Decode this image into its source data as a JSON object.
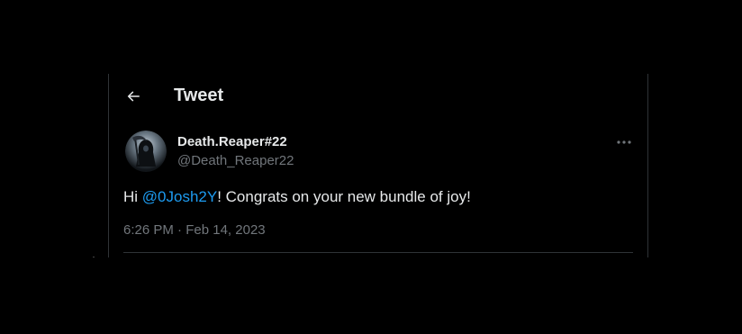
{
  "header": {
    "title": "Tweet",
    "back_icon": "arrow-left-icon"
  },
  "tweet": {
    "author": {
      "display_name": "Death.Reaper#22",
      "handle": "@Death_Reaper22",
      "avatar_icon": "avatar-image"
    },
    "more_icon": "more-options-icon",
    "text_before": "Hi ",
    "mention": "@0Josh2Y",
    "text_after": "! Congrats on your new bundle of joy!",
    "time": "6:26 PM",
    "separator": " · ",
    "date": "Feb 14, 2023"
  },
  "colors": {
    "background": "#000000",
    "text_primary": "#e7e9ea",
    "text_secondary": "#71767b",
    "link": "#1d9bf0",
    "border": "#2f3336"
  }
}
